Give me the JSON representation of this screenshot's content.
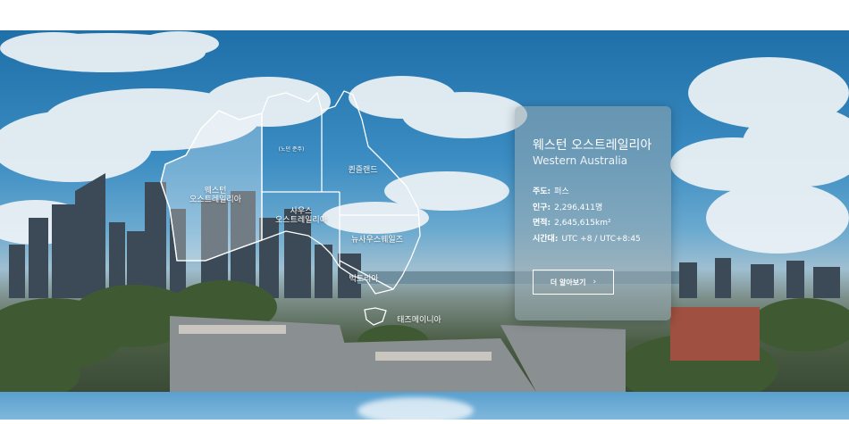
{
  "map": {
    "labels": {
      "western_australia": "웨스턴\n오스트레일리아",
      "northern_territory": "(노던 준주)",
      "queensland": "퀸즐랜드",
      "south_australia": "사우스\n오스트레일리아",
      "new_south_wales": "뉴사우스웨일즈",
      "victoria": "빅토리아",
      "tasmania": "태즈메이니아"
    },
    "highlighted_state": "western_australia"
  },
  "info_card": {
    "title": "웨스턴 오스트레일리아",
    "subtitle": "Western Australia",
    "facts": [
      {
        "label": "주도:",
        "value": "퍼스"
      },
      {
        "label": "인구:",
        "value": "2,296,411명"
      },
      {
        "label": "면적:",
        "value": "2,645,615km²"
      },
      {
        "label": "시간대:",
        "value": "UTC +8 / UTC+8:45"
      }
    ],
    "button_label": "더 알아보기",
    "button_icon": "chevron-right-icon"
  },
  "colors": {
    "sky": "#2f7fb8",
    "outline": "#ffffff",
    "card_bg": "#96a8af"
  }
}
